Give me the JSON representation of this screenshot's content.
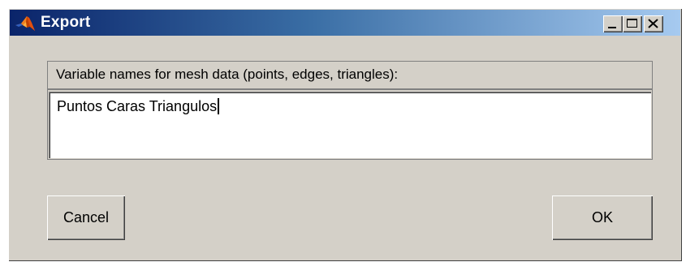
{
  "window": {
    "title": "Export",
    "icon": "matlab-logo-icon",
    "controls": [
      "minimize-icon",
      "maximize-icon",
      "close-icon"
    ]
  },
  "panel": {
    "label": "Variable names for mesh data (points, edges, triangles):",
    "input_value": "Puntos Caras Triangulos"
  },
  "buttons": {
    "cancel_label": "Cancel",
    "ok_label": "OK"
  },
  "colors": {
    "titlebar_start": "#0a246a",
    "titlebar_end": "#a6caf0",
    "dialog_bg": "#d4d0c8"
  }
}
